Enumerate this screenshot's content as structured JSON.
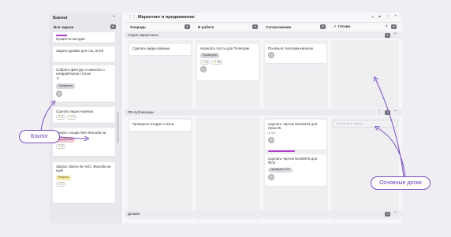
{
  "backlog": {
    "title": "Бэклог",
    "column": {
      "label": "Все задачи",
      "count": "6"
    },
    "cards": [
      {
        "title": "Провести кастдев"
      },
      {
        "title": "Задачи дизайн для соц сетей"
      },
      {
        "title": "Собрать фактуру и написать с копирайтером статью",
        "tag": "Проверено"
      },
      {
        "title": "Сделать видео-превью",
        "pills": [
          "4",
          "1"
        ]
      },
      {
        "title": "Запрос Альфа №% Жалоба на",
        "tag": "Доработка",
        "pills": [
          "3"
        ]
      },
      {
        "title": "Запрос Омега № %03. Жалоба на шум",
        "tag": "Решено",
        "pills": [
          "3"
        ]
      }
    ]
  },
  "board": {
    "title": "Маркетинг и продвижение",
    "columns": [
      {
        "label": "Очередь",
        "count": "2"
      },
      {
        "label": "В работе",
        "count": "1"
      },
      {
        "label": "Согласование",
        "count": "3"
      },
      {
        "label": "Готово",
        "count": "0"
      }
    ],
    "lanes": [
      {
        "label": "Отдел маркетинга",
        "count": "5"
      },
      {
        "label": "PR-публикации",
        "count": "3"
      },
      {
        "label": "Дизайн",
        "count": "0"
      }
    ],
    "cards": {
      "lane1_queue": "Сделать видео-превью",
      "lane1_work": {
        "title": "Написать посты для Телеграм",
        "tag": "Проверено",
        "pills": [
          "5",
          "10"
        ]
      },
      "lane1_approval": "Посевы в телеграм-каналах",
      "lane2_queue": "Проверить вторую статью",
      "lane2_approval_1": {
        "title": "Сделать чертеж №234234 для Луна-25",
        "sub": "0/4"
      },
      "lane2_approval_2": {
        "title": "Сделать чертеж №180976 для ФСК",
        "tag": "Проверен ОТК"
      },
      "lane2_done_placeholder": "Перенесите задачу"
    }
  },
  "callouts": {
    "backlog": "Бэклог",
    "boards": "Основные доски"
  },
  "colors": {
    "accent": "#7a4cc0"
  }
}
